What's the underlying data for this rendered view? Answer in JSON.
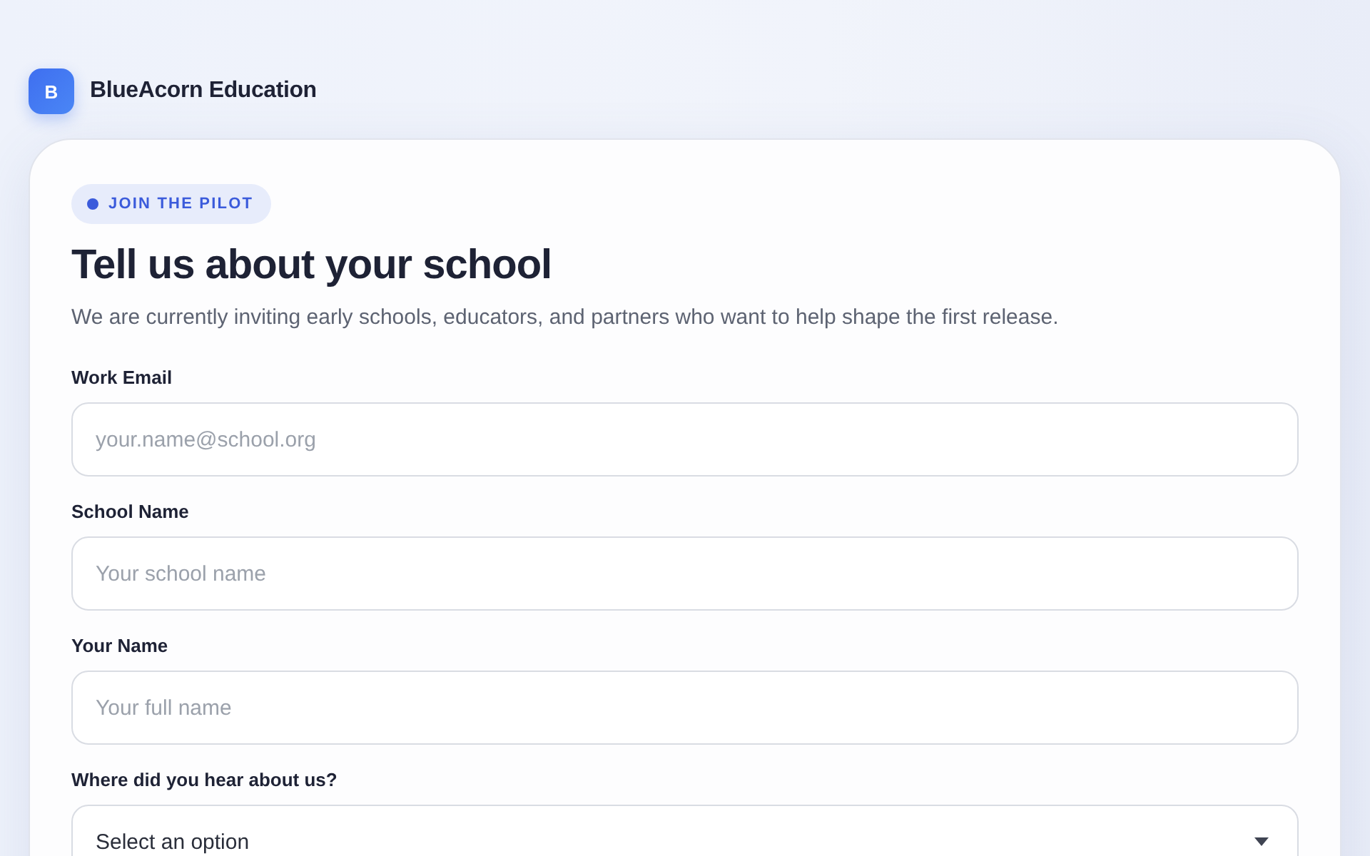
{
  "header": {
    "logo_letter": "B",
    "brand": "BlueAcorn Education"
  },
  "card": {
    "badge": "JOIN THE PILOT",
    "title": "Tell us about your school",
    "subtitle": "We are currently inviting early schools, educators, and partners who want to help shape the first release."
  },
  "fields": [
    {
      "kind": "input",
      "label": "Work Email",
      "placeholder": "your.name@school.org"
    },
    {
      "kind": "input",
      "label": "School Name",
      "placeholder": "Your school name"
    },
    {
      "kind": "input",
      "label": "Your Name",
      "placeholder": "Your full name"
    },
    {
      "kind": "select",
      "label": "Where did you hear about us?",
      "value": "Select an option"
    }
  ]
}
